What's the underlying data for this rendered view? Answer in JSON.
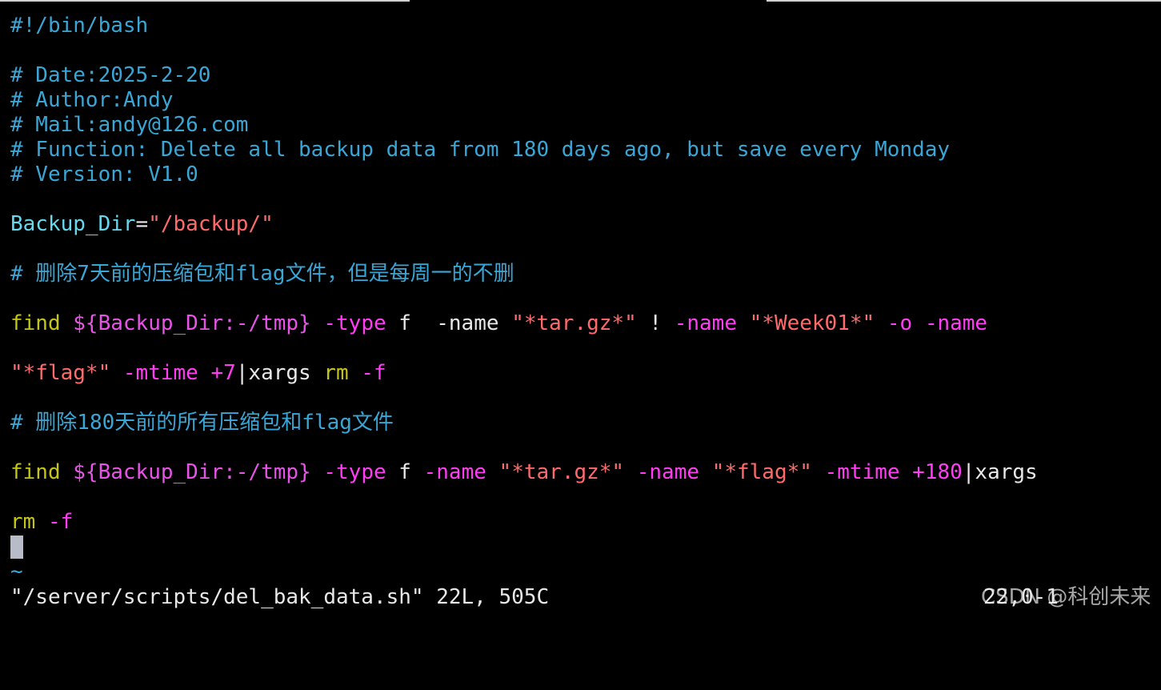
{
  "colors": {
    "background": "#000000",
    "comment": "#3aa6d6",
    "identifier": "#66d9ef",
    "string": "#ff6b6b",
    "command": "#c5c519",
    "option": "#ff3df3",
    "expansion": "#e854e8",
    "plain": "#e8e8e8",
    "cursor": "#b7bcc8"
  },
  "buffer": {
    "lines": [
      {
        "tokens": [
          {
            "text": "#!/bin/bash",
            "kind": "comment"
          }
        ]
      },
      {
        "tokens": []
      },
      {
        "tokens": [
          {
            "text": "# Date:2025-2-20",
            "kind": "comment"
          }
        ]
      },
      {
        "tokens": [
          {
            "text": "# Author:Andy",
            "kind": "comment"
          }
        ]
      },
      {
        "tokens": [
          {
            "text": "# Mail:andy@126.com",
            "kind": "comment"
          }
        ]
      },
      {
        "tokens": [
          {
            "text": "# Function: Delete all backup data from 180 days ago, but save every Monday",
            "kind": "comment"
          }
        ]
      },
      {
        "tokens": [
          {
            "text": "# Version: V1.0",
            "kind": "comment"
          }
        ]
      },
      {
        "tokens": []
      },
      {
        "tokens": [
          {
            "text": "Backup_Dir",
            "kind": "identifier"
          },
          {
            "text": "=",
            "kind": "plain"
          },
          {
            "text": "\"/backup/\"",
            "kind": "string"
          }
        ]
      },
      {
        "tokens": []
      },
      {
        "tokens": [
          {
            "text": "# 删除7天前的压缩包和flag文件，但是每周一的不删",
            "kind": "comment"
          }
        ]
      },
      {
        "tokens": []
      },
      {
        "tokens": [
          {
            "text": "find",
            "kind": "command"
          },
          {
            "text": " ",
            "kind": "plain"
          },
          {
            "text": "${Backup_Dir:-/tmp}",
            "kind": "expansion"
          },
          {
            "text": " ",
            "kind": "plain"
          },
          {
            "text": "-type",
            "kind": "option"
          },
          {
            "text": " f  -name ",
            "kind": "plain"
          },
          {
            "text": "\"*tar.gz*\"",
            "kind": "string"
          },
          {
            "text": " ! ",
            "kind": "plain"
          },
          {
            "text": "-name",
            "kind": "option"
          },
          {
            "text": " ",
            "kind": "plain"
          },
          {
            "text": "\"*Week01*\"",
            "kind": "string"
          },
          {
            "text": " ",
            "kind": "plain"
          },
          {
            "text": "-o",
            "kind": "option"
          },
          {
            "text": " ",
            "kind": "plain"
          },
          {
            "text": "-name",
            "kind": "option"
          }
        ]
      },
      {
        "tokens": []
      },
      {
        "tokens": [
          {
            "text": "\"*flag*\"",
            "kind": "string"
          },
          {
            "text": " ",
            "kind": "plain"
          },
          {
            "text": "-mtime",
            "kind": "option"
          },
          {
            "text": " ",
            "kind": "plain"
          },
          {
            "text": "+7",
            "kind": "option"
          },
          {
            "text": "|xargs ",
            "kind": "plain"
          },
          {
            "text": "rm",
            "kind": "command"
          },
          {
            "text": " ",
            "kind": "plain"
          },
          {
            "text": "-f",
            "kind": "option"
          }
        ]
      },
      {
        "tokens": []
      },
      {
        "tokens": [
          {
            "text": "# 删除180天前的所有压缩包和flag文件",
            "kind": "comment"
          }
        ]
      },
      {
        "tokens": []
      },
      {
        "tokens": [
          {
            "text": "find",
            "kind": "command"
          },
          {
            "text": " ",
            "kind": "plain"
          },
          {
            "text": "${Backup_Dir:-/tmp}",
            "kind": "expansion"
          },
          {
            "text": " ",
            "kind": "plain"
          },
          {
            "text": "-type",
            "kind": "option"
          },
          {
            "text": " f ",
            "kind": "plain"
          },
          {
            "text": "-name",
            "kind": "option"
          },
          {
            "text": " ",
            "kind": "plain"
          },
          {
            "text": "\"*tar.gz*\"",
            "kind": "string"
          },
          {
            "text": " ",
            "kind": "plain"
          },
          {
            "text": "-name",
            "kind": "option"
          },
          {
            "text": " ",
            "kind": "plain"
          },
          {
            "text": "\"*flag*\"",
            "kind": "string"
          },
          {
            "text": " ",
            "kind": "plain"
          },
          {
            "text": "-mtime",
            "kind": "option"
          },
          {
            "text": " ",
            "kind": "plain"
          },
          {
            "text": "+180",
            "kind": "option"
          },
          {
            "text": "|xargs",
            "kind": "plain"
          }
        ]
      },
      {
        "tokens": []
      },
      {
        "tokens": [
          {
            "text": "rm",
            "kind": "command"
          },
          {
            "text": " ",
            "kind": "plain"
          },
          {
            "text": "-f",
            "kind": "option"
          }
        ]
      },
      {
        "tokens": [],
        "cursor": true
      },
      {
        "tokens": [
          {
            "text": "~",
            "kind": "comment"
          }
        ]
      }
    ]
  },
  "statusline": {
    "file_info": "\"/server/scripts/del_bak_data.sh\" 22L, 505C",
    "cursor_pos": "22,0-1",
    "watermark": "CSDN @科创未来"
  }
}
